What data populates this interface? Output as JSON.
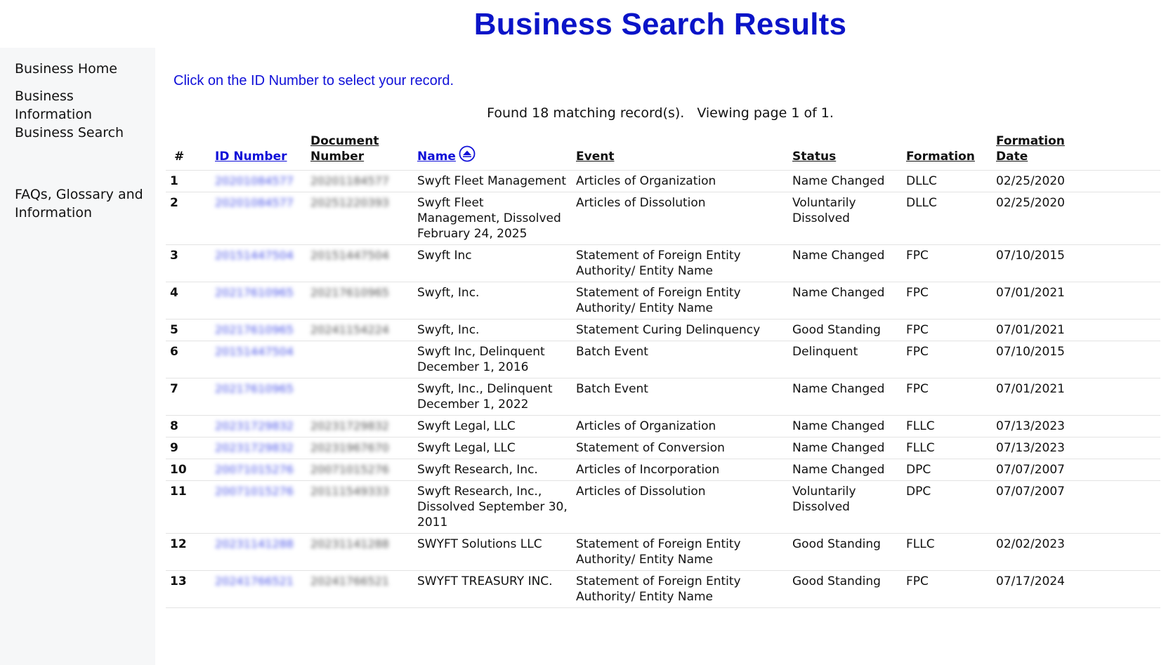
{
  "page": {
    "title": "Business Search Results",
    "instruction": "Click on the ID Number to select your record.",
    "summary_found": "Found 18 matching record(s).",
    "summary_page": "Viewing page 1 of 1."
  },
  "sidebar": {
    "items": [
      {
        "label": "Business Home"
      },
      {
        "label": "Business Information Business Search"
      },
      {
        "label": "FAQs, Glossary and Information"
      }
    ]
  },
  "table": {
    "headers": {
      "num": "#",
      "id": "ID Number",
      "doc": "Document Number",
      "name": "Name",
      "event": "Event",
      "status": "Status",
      "formation": "Formation",
      "formation_date": "Formation Date"
    },
    "sort_icon": "sort-ascending-icon",
    "rows": [
      {
        "num": "1",
        "id": "20201084577",
        "doc": "20201184577",
        "name": "Swyft Fleet Management",
        "event": "Articles of Organization",
        "status": "Name Changed",
        "formation": "DLLC",
        "date": "02/25/2020"
      },
      {
        "num": "2",
        "id": "20201084577",
        "doc": "20251220393",
        "name": "Swyft Fleet Management, Dissolved February 24, 2025",
        "event": "Articles of Dissolution",
        "status": "Voluntarily Dissolved",
        "formation": "DLLC",
        "date": "02/25/2020"
      },
      {
        "num": "3",
        "id": "20151447504",
        "doc": "20151447504",
        "name": "Swyft Inc",
        "event": "Statement of Foreign Entity Authority/ Entity Name",
        "status": "Name Changed",
        "formation": "FPC",
        "date": "07/10/2015"
      },
      {
        "num": "4",
        "id": "20217610965",
        "doc": "20217610965",
        "name": "Swyft, Inc.",
        "event": "Statement of Foreign Entity Authority/ Entity Name",
        "status": "Name Changed",
        "formation": "FPC",
        "date": "07/01/2021"
      },
      {
        "num": "5",
        "id": "20217610965",
        "doc": "20241154224",
        "name": "Swyft, Inc.",
        "event": "Statement Curing Delinquency",
        "status": "Good Standing",
        "formation": "FPC",
        "date": "07/01/2021"
      },
      {
        "num": "6",
        "id": "20151447504",
        "doc": "",
        "name": "Swyft Inc, Delinquent December 1, 2016",
        "event": "Batch Event",
        "status": "Delinquent",
        "formation": "FPC",
        "date": "07/10/2015"
      },
      {
        "num": "7",
        "id": "20217610965",
        "doc": "",
        "name": "Swyft, Inc., Delinquent December 1, 2022",
        "event": "Batch Event",
        "status": "Name Changed",
        "formation": "FPC",
        "date": "07/01/2021"
      },
      {
        "num": "8",
        "id": "20231729832",
        "doc": "20231729832",
        "name": "Swyft Legal, LLC",
        "event": "Articles of Organization",
        "status": "Name Changed",
        "formation": "FLLC",
        "date": "07/13/2023"
      },
      {
        "num": "9",
        "id": "20231729832",
        "doc": "20231967670",
        "name": "Swyft Legal, LLC",
        "event": "Statement of Conversion",
        "status": "Name Changed",
        "formation": "FLLC",
        "date": "07/13/2023"
      },
      {
        "num": "10",
        "id": "20071015276",
        "doc": "20071015276",
        "name": "Swyft Research, Inc.",
        "event": "Articles of Incorporation",
        "status": "Name Changed",
        "formation": "DPC",
        "date": "07/07/2007"
      },
      {
        "num": "11",
        "id": "20071015276",
        "doc": "20111549333",
        "name": "Swyft Research, Inc., Dissolved September 30, 2011",
        "event": "Articles of Dissolution",
        "status": "Voluntarily Dissolved",
        "formation": "DPC",
        "date": "07/07/2007"
      },
      {
        "num": "12",
        "id": "20231141288",
        "doc": "20231141288",
        "name": "SWYFT Solutions LLC",
        "event": "Statement of Foreign Entity Authority/ Entity Name",
        "status": "Good Standing",
        "formation": "FLLC",
        "date": "02/02/2023"
      },
      {
        "num": "13",
        "id": "20241766521",
        "doc": "20241766521",
        "name": "SWYFT TREASURY INC.",
        "event": "Statement of Foreign Entity Authority/ Entity Name",
        "status": "Good Standing",
        "formation": "FPC",
        "date": "07/17/2024"
      }
    ]
  },
  "colors": {
    "title": "#0a14c8",
    "link": "#1010d8",
    "sidebar_bg": "#f6f7f8"
  }
}
